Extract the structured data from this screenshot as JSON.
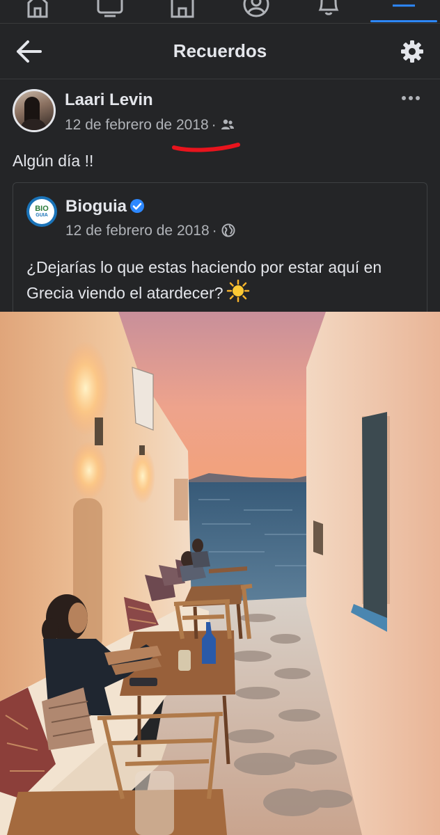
{
  "tabs": [
    {
      "name": "home",
      "active": false
    },
    {
      "name": "watch",
      "active": false
    },
    {
      "name": "marketplace",
      "active": false
    },
    {
      "name": "profile",
      "active": false
    },
    {
      "name": "notifications",
      "active": false
    },
    {
      "name": "menu",
      "active": true
    }
  ],
  "header": {
    "title": "Recuerdos",
    "back_icon": "arrow-left-icon",
    "settings_icon": "gear-icon"
  },
  "post": {
    "author": "Laari Levin",
    "date": "12 de febrero de 2018",
    "separator": "·",
    "audience_icon": "friends-icon",
    "text": "Algún día !!",
    "more_icon": "more-dots-icon",
    "annotation_color": "#e8141d"
  },
  "shared_post": {
    "page_name": "Bioguia",
    "logo_text_top": "BIO",
    "logo_text_bottom": "GUIA",
    "verified": true,
    "date": "12 de febrero de 2018",
    "separator": "·",
    "audience_icon": "globe-icon",
    "text": "¿Dejarías lo que estas haciendo por estar aquí en Grecia viendo el atardecer?",
    "emoji_icon": "sun-emoji-icon"
  },
  "colors": {
    "background": "#242527",
    "text_primary": "#e4e6eb",
    "text_secondary": "#b0b3b8",
    "accent": "#2d88ff",
    "verified": "#2d88ff"
  }
}
